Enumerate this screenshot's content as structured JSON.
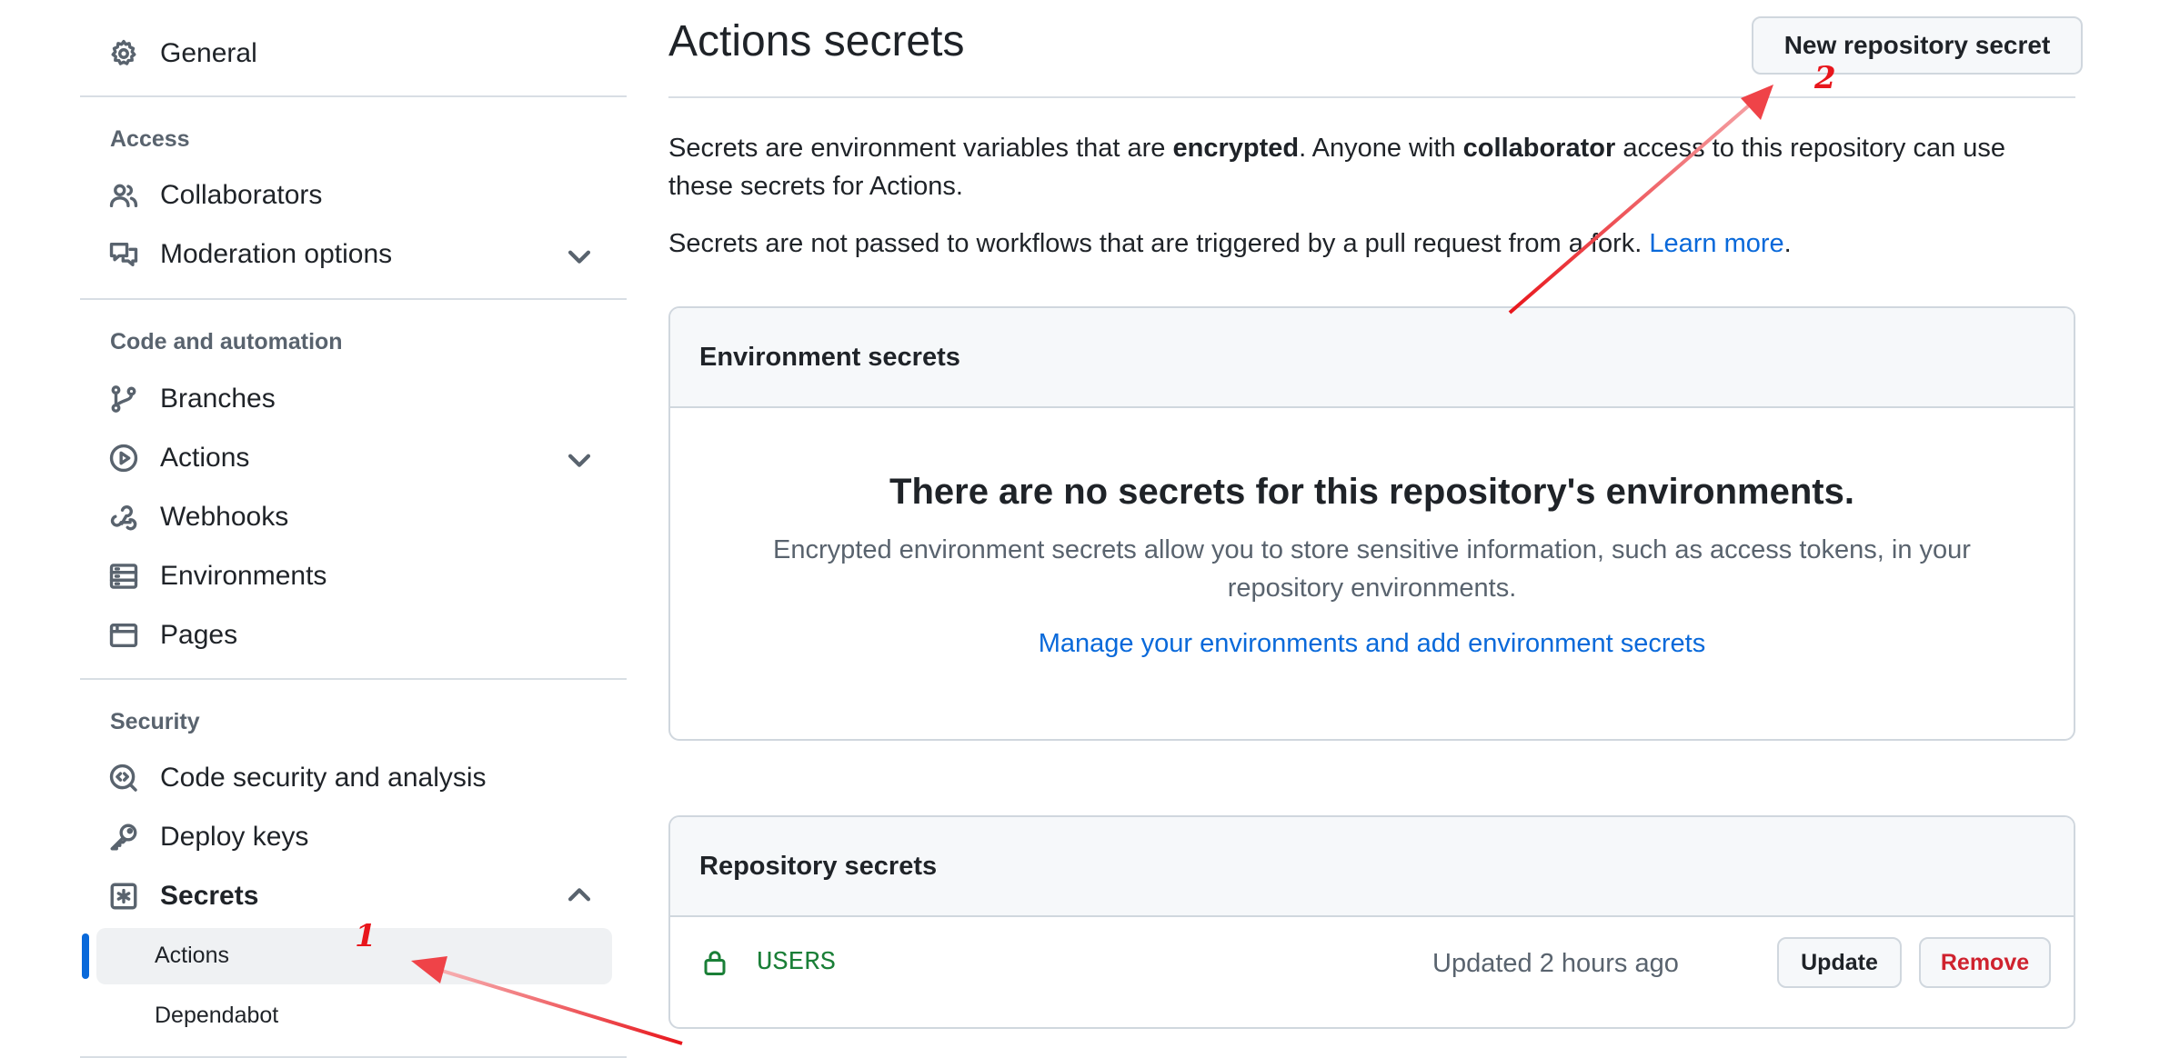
{
  "sidebar": {
    "general": "General",
    "access_heading": "Access",
    "collaborators": "Collaborators",
    "moderation": "Moderation options",
    "code_heading": "Code and automation",
    "branches": "Branches",
    "actions": "Actions",
    "webhooks": "Webhooks",
    "environments": "Environments",
    "pages": "Pages",
    "security_heading": "Security",
    "code_security": "Code security and analysis",
    "deploy_keys": "Deploy keys",
    "secrets": "Secrets",
    "secrets_actions": "Actions",
    "secrets_dependabot": "Dependabot"
  },
  "main": {
    "title": "Actions secrets",
    "new_secret_button": "New repository secret",
    "intro": {
      "p1_a": "Secrets are environment variables that are ",
      "p1_b": "encrypted",
      "p1_c": ". Anyone with ",
      "p1_d": "collaborator",
      "p1_e": " access to this repository can use",
      "p1_f": "these secrets for Actions.",
      "p2_a": "Secrets are not passed to workflows that are triggered by a pull request from a fork. ",
      "p2_link": "Learn more",
      "p2_b": "."
    },
    "env_box": {
      "header": "Environment secrets",
      "empty_title": "There are no secrets for this repository's environments.",
      "empty_desc_1": "Encrypted environment secrets allow you to store sensitive information, such as access tokens, in your",
      "empty_desc_2": "repository environments.",
      "manage_link": "Manage your environments and add environment secrets"
    },
    "repo_box": {
      "header": "Repository secrets",
      "secret_name": "USERS",
      "updated": "Updated 2 hours ago",
      "update_button": "Update",
      "remove_button": "Remove"
    }
  },
  "annotations": {
    "step1": "1",
    "step2": "2"
  },
  "colors": {
    "accent_link": "#0969da",
    "active_bar": "#0969da",
    "secret_green": "#1a7f37",
    "danger": "#cf222e",
    "annotation": "#e8161c"
  }
}
